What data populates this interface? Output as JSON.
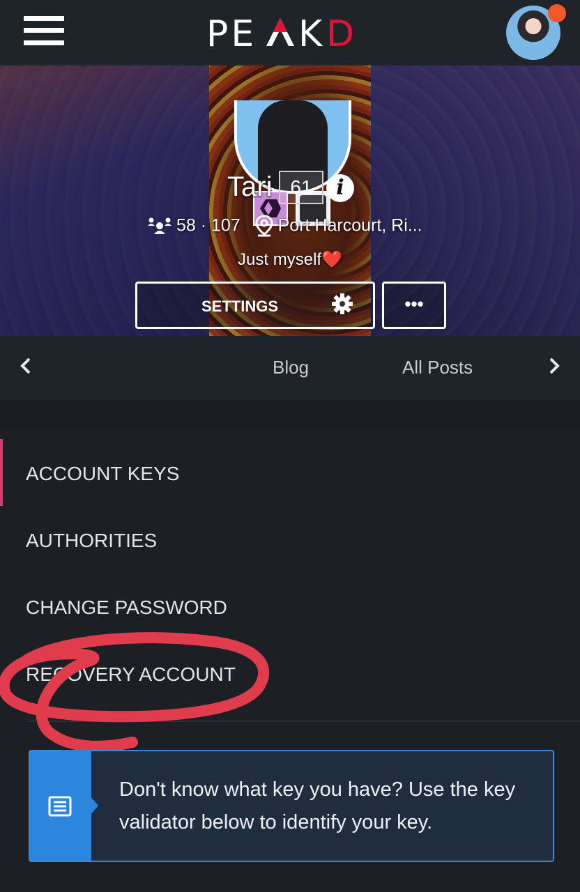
{
  "header": {
    "logo_text": "PEAKD",
    "logo_accent": "#e31337"
  },
  "profile": {
    "name": "Tari",
    "reputation": "61",
    "info_glyph": "i",
    "followers": "58",
    "following": "107",
    "location": "Port Harcourt, Ri...",
    "bio": "Just myself❤️",
    "settings_label": "SETTINGS",
    "more_label": "•••"
  },
  "tabs": {
    "items": [
      "Blog",
      "All Posts"
    ]
  },
  "menu": {
    "items": [
      "ACCOUNT KEYS",
      "AUTHORITIES",
      "CHANGE PASSWORD",
      "RECOVERY ACCOUNT"
    ],
    "active_index": 0,
    "active_color": "#e0376b"
  },
  "notice": {
    "text": "Don't know what key you have? Use the key validator below to identify your key.",
    "accent": "#2c86de"
  },
  "annotation": {
    "color": "#e03c4c"
  }
}
